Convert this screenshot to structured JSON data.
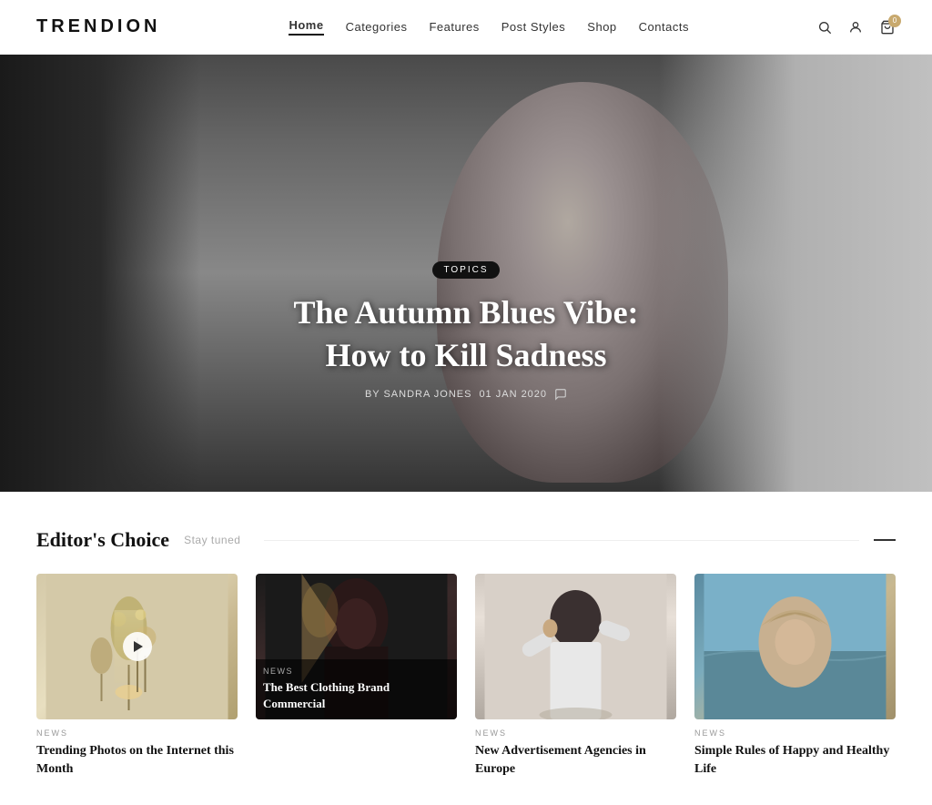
{
  "logo": "TRENDION",
  "nav": {
    "items": [
      {
        "label": "Home",
        "active": true
      },
      {
        "label": "Categories",
        "active": false
      },
      {
        "label": "Features",
        "active": false
      },
      {
        "label": "Post Styles",
        "active": false
      },
      {
        "label": "Shop",
        "active": false
      },
      {
        "label": "Contacts",
        "active": false
      }
    ]
  },
  "icons": {
    "search": "🔍",
    "user": "👤",
    "cart": "🛒",
    "cart_count": "0",
    "play": "▶"
  },
  "hero": {
    "tag": "TOPICS",
    "title_line1": "The Autumn Blues Vibe:",
    "title_line2": "How to Kill Sadness",
    "author_label": "BY SANDRA JONES",
    "date": "01 JAN 2020"
  },
  "editors_choice": {
    "title": "Editor's Choice",
    "subtitle": "Stay tuned",
    "cards": [
      {
        "category": "NEWS",
        "title": "Trending Photos on the Internet this Month",
        "has_play": true,
        "image_type": "plants"
      },
      {
        "category": "NEWS",
        "title": "The Best Clothing Brand Commercial",
        "has_overlay": true,
        "image_type": "dark-fashion"
      },
      {
        "category": "NEWS",
        "title": "New Advertisement Agencies in Europe",
        "has_play": false,
        "image_type": "person-white"
      },
      {
        "category": "NEWS",
        "title": "Simple Rules of Happy and Healthy Life",
        "has_play": false,
        "image_type": "beach-hood"
      }
    ]
  }
}
